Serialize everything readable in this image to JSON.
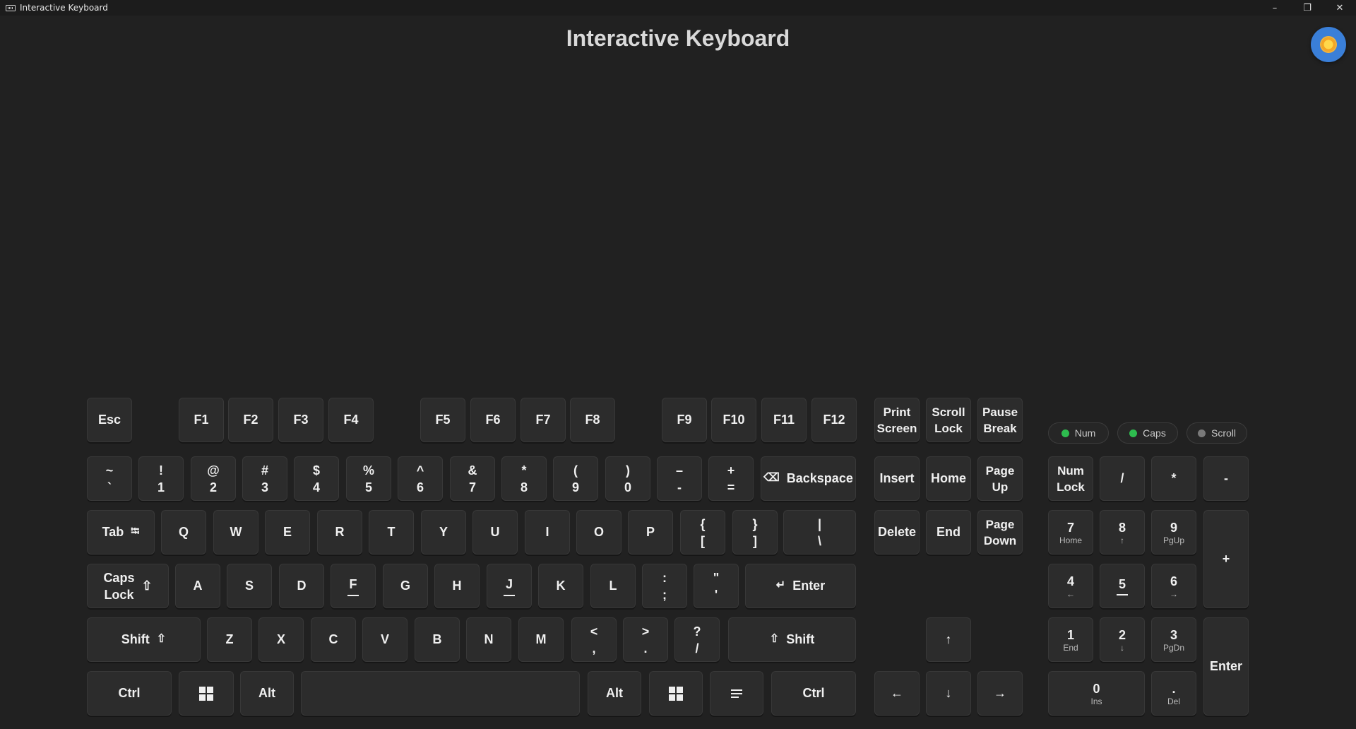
{
  "window": {
    "title": "Interactive Keyboard",
    "minimize": "–",
    "maximize": "❐",
    "close": "✕"
  },
  "header": {
    "title": "Interactive Keyboard"
  },
  "theme_toggle": {
    "icon": "sun-icon",
    "color": "#3a7fd8"
  },
  "indicators": [
    {
      "label": "Num",
      "color": "#2ebd4f"
    },
    {
      "label": "Caps",
      "color": "#2ebd4f"
    },
    {
      "label": "Scroll",
      "color": "#7a7a7a"
    }
  ],
  "keys": {
    "esc": "Esc",
    "f": [
      "F1",
      "F2",
      "F3",
      "F4",
      "F5",
      "F6",
      "F7",
      "F8",
      "F9",
      "F10",
      "F11",
      "F12"
    ],
    "print": [
      "Print",
      "Screen"
    ],
    "scroll": [
      "Scroll",
      "Lock"
    ],
    "pause": [
      "Pause",
      "Break"
    ],
    "number_row": [
      {
        "top": "~",
        "bot": "`"
      },
      {
        "top": "!",
        "bot": "1"
      },
      {
        "top": "@",
        "bot": "2"
      },
      {
        "top": "#",
        "bot": "3"
      },
      {
        "top": "$",
        "bot": "4"
      },
      {
        "top": "%",
        "bot": "5"
      },
      {
        "top": "^",
        "bot": "6"
      },
      {
        "top": "&",
        "bot": "7"
      },
      {
        "top": "*",
        "bot": "8"
      },
      {
        "top": "(",
        "bot": "9"
      },
      {
        "top": ")",
        "bot": "0"
      },
      {
        "top": "–",
        "bot": "-"
      },
      {
        "top": "+",
        "bot": "="
      }
    ],
    "backspace": "Backspace",
    "backspace_icon": "⌫",
    "tab": "Tab",
    "tab_icon": "⭾",
    "qrow": [
      "Q",
      "W",
      "E",
      "R",
      "T",
      "Y",
      "U",
      "I",
      "O",
      "P"
    ],
    "bracket_l": {
      "top": "{",
      "bot": "["
    },
    "bracket_r": {
      "top": "}",
      "bot": "]"
    },
    "backslash": {
      "top": "|",
      "bot": "\\"
    },
    "caps": [
      "Caps",
      "Lock"
    ],
    "caps_icon": "⇧",
    "arow": [
      "A",
      "S",
      "D",
      "F",
      "G",
      "H",
      "J",
      "K",
      "L"
    ],
    "semicolon": {
      "top": ":",
      "bot": ";"
    },
    "quote": {
      "top": "\"",
      "bot": "'"
    },
    "enter": "Enter",
    "enter_icon": "↵",
    "shift": "Shift",
    "shift_icon": "⇧",
    "zrow": [
      "Z",
      "X",
      "C",
      "V",
      "B",
      "N",
      "M"
    ],
    "comma": {
      "top": "<",
      "bot": ","
    },
    "period": {
      "top": ">",
      "bot": "."
    },
    "slash": {
      "top": "?",
      "bot": "/"
    },
    "ctrl": "Ctrl",
    "alt": "Alt",
    "insert": "Insert",
    "home": "Home",
    "pageup": [
      "Page",
      "Up"
    ],
    "delete": "Delete",
    "end": "End",
    "pagedown": [
      "Page",
      "Down"
    ],
    "arrow_up": "↑",
    "arrow_left": "←",
    "arrow_down": "↓",
    "arrow_right": "→",
    "numpad": {
      "numlock": [
        "Num",
        "Lock"
      ],
      "div": "/",
      "mul": "*",
      "sub": "-",
      "add": "+",
      "enter": "Enter",
      "k7": {
        "main": "7",
        "sub": "Home"
      },
      "k8": {
        "main": "8",
        "sub": "↑"
      },
      "k9": {
        "main": "9",
        "sub": "PgUp"
      },
      "k4": {
        "main": "4",
        "sub": "←"
      },
      "k5": {
        "main": "5",
        "sub": ""
      },
      "k6": {
        "main": "6",
        "sub": "→"
      },
      "k1": {
        "main": "1",
        "sub": "End"
      },
      "k2": {
        "main": "2",
        "sub": "↓"
      },
      "k3": {
        "main": "3",
        "sub": "PgDn"
      },
      "k0": {
        "main": "0",
        "sub": "Ins"
      },
      "dot": {
        "main": ".",
        "sub": "Del"
      }
    }
  }
}
